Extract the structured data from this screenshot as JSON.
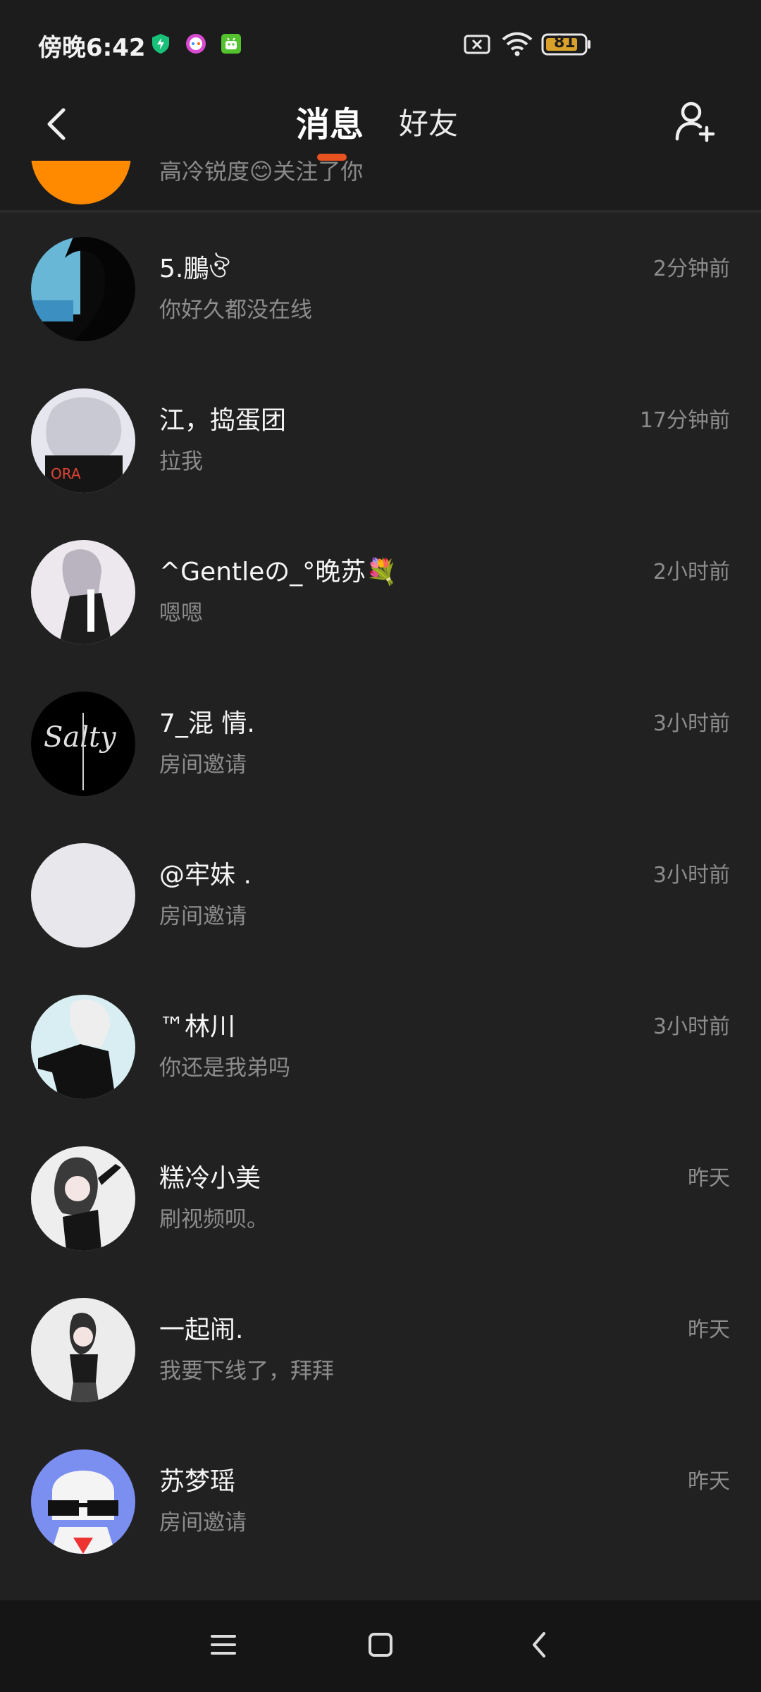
{
  "status_bar": {
    "time": "傍晚6:42",
    "battery": "81",
    "icons": [
      "shield-icon",
      "game-icon",
      "android-icon",
      "sim-error-icon",
      "wifi-icon",
      "battery-icon"
    ]
  },
  "header": {
    "tabs": [
      {
        "label": "消息",
        "active": true
      },
      {
        "label": "好友",
        "active": false
      }
    ],
    "accent_color": "#e8531f"
  },
  "partial_row": {
    "text": "高冷锐度😊关注了你"
  },
  "conversations": [
    {
      "name": "5.鵬ঔ",
      "preview": "你好久都没在线",
      "time": "2分钟前"
    },
    {
      "name": "江，捣蛋团",
      "preview": "拉我",
      "time": "17分钟前"
    },
    {
      "name": "^Gentleの_°晚苏💐",
      "preview": "嗯嗯",
      "time": "2小时前"
    },
    {
      "name": "7_混  情.",
      "preview": "房间邀请",
      "time": "3小时前"
    },
    {
      "name": "@牢妹  .",
      "preview": "房间邀请",
      "time": "3小时前"
    },
    {
      "name": "™林川",
      "preview": "你还是我弟吗",
      "time": "3小时前"
    },
    {
      "name": "糕冷小美",
      "preview": "刷视频呗。",
      "time": "昨天"
    },
    {
      "name": "一起闹.",
      "preview": "我要下线了，拜拜",
      "time": "昨天"
    },
    {
      "name": "苏梦瑶",
      "preview": "房间邀请",
      "time": "昨天"
    }
  ],
  "navbar": {
    "icons": [
      "menu-icon",
      "home-icon",
      "back-icon"
    ]
  }
}
